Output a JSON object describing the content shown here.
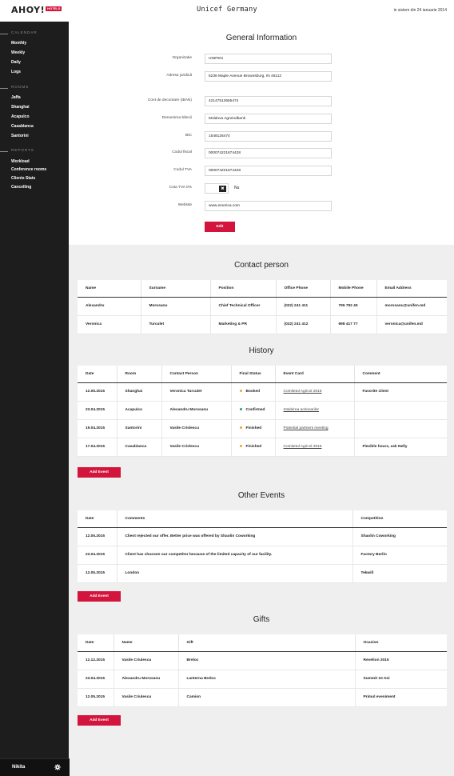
{
  "header": {
    "logo": "AHOY!",
    "logo_tag": "HOTELS",
    "title": "Unicef Germany",
    "since": "in sistem din 24 ianuarie 2014"
  },
  "sidebar": {
    "sections": [
      {
        "title": "CALENDAR",
        "items": [
          "Monthly",
          "Weekly",
          "Daily",
          "Logs"
        ]
      },
      {
        "title": "ROOMS",
        "items": [
          "Jaffa",
          "Shanghai",
          "Acapulco",
          "Casablanca",
          "Santorini"
        ]
      },
      {
        "title": "REPORTS",
        "items": [
          "Workload",
          "Conference rooms",
          "Clients Stats",
          "Cancelling"
        ]
      }
    ],
    "user": "Nikita",
    "settings_icon": "gear-icon"
  },
  "general": {
    "title": "General Information",
    "fields": [
      {
        "label": "Organizatie",
        "value": "UNIFEN"
      },
      {
        "label": "Adresa juridică",
        "value": "6236 Maple Avenue Brownsburg, IN 46112"
      },
      {
        "label": "Cont de decontare (IBAN)",
        "value": "42147513665474"
      },
      {
        "label": "Denumirea băncii",
        "value": "Moldova Agroindbank"
      },
      {
        "label": "BIC",
        "value": "1548126474"
      },
      {
        "label": "Codul fiscal",
        "value": "000074221674428"
      },
      {
        "label": "Codul TVA",
        "value": "000074221674428"
      }
    ],
    "vat": {
      "label": "Cota TVA 0%",
      "checked_symbol": "✖",
      "answer": "Nu"
    },
    "website": {
      "label": "Website",
      "value": "www.emerica.com"
    },
    "edit_label": "Edit"
  },
  "contact": {
    "title": "Contact person",
    "headers": [
      "Name",
      "Surname",
      "Position",
      "Office Phone",
      "Mobile Phone",
      "Email Address"
    ],
    "rows": [
      [
        "Alexandru",
        "Morosanu",
        "Chief Technical Officer",
        "(022) 241 411",
        "795 792 45",
        "morosanu@unifen.md"
      ],
      [
        "Veronica",
        "Turculet",
        "Marketing & PR",
        "(022) 241 412",
        "698 417 77",
        "veronica@unifen.md"
      ]
    ]
  },
  "history": {
    "title": "History",
    "headers": [
      "Date",
      "Room",
      "Contact Person",
      "Final Status",
      "Event Card",
      "Comment"
    ],
    "rows": [
      {
        "date": "12.05.2015",
        "room": "Shanghai",
        "contact": "Veronica Turculet",
        "status": "Booked",
        "status_color": "#f0a030",
        "card": "Comitetul Agricol 2016",
        "comment": "Favorite client"
      },
      {
        "date": "23.04.2015",
        "room": "Acapulco",
        "contact": "Alexandru Morosanu",
        "status": "Confirmed",
        "status_color": "#21a06a",
        "card": "Intalnirea actionarilor",
        "comment": ""
      },
      {
        "date": "19.04.2015",
        "room": "Santorini",
        "contact": "Vasile Crislescu",
        "status": "Finished",
        "status_color": "#f0a030",
        "card": "Potential partners meeting",
        "comment": ""
      },
      {
        "date": "17.04.2015",
        "room": "Casablanca",
        "contact": "Vasile Crislescu",
        "status": "Finished",
        "status_color": "#f0a030",
        "card": "Comitetul Agricol 2016",
        "comment": "Flexible hours, ask Nelly"
      }
    ],
    "add_label": "Add Event"
  },
  "other_events": {
    "title": "Other Events",
    "headers": [
      "Date",
      "Comments",
      "Competition"
    ],
    "rows": [
      [
        "12.05.2015",
        "Client rejected our offer. Better price was offered by Shaolin Coworking",
        "Shaolin Coworking"
      ],
      [
        "23.04.2015",
        "Client has choosen our competitor because of the limited capacity of our facility.",
        "Factory Berlin"
      ],
      [
        "12.05.2015",
        "London",
        "Tekwill"
      ]
    ],
    "add_label": "Add Event"
  },
  "gifts": {
    "title": "Gifts",
    "headers": [
      "Date",
      "Name",
      "Gift",
      "Ocasion"
    ],
    "rows": [
      [
        "12.12.2015",
        "Vasile Criulescu",
        "Brelоc",
        "Revelion 2015"
      ],
      [
        "23.04.2015",
        "Alexandru Morosanu",
        "Lanterna Breloc",
        "Summit 10 Ani"
      ],
      [
        "12.05.2015",
        "Vasile Criulescu",
        "Camion",
        "Primul eveniment"
      ]
    ],
    "add_label": "Add Event"
  },
  "colors": {
    "accent": "#d3143c",
    "sidebar": "#1d1d1d",
    "page": "#efefef"
  }
}
